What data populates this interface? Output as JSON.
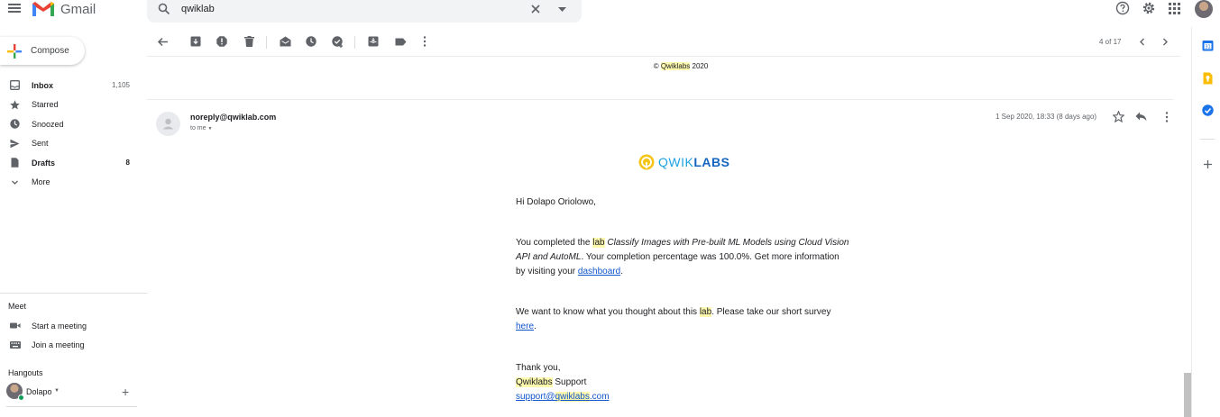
{
  "app": {
    "name": "Gmail"
  },
  "search": {
    "query": "qwiklab"
  },
  "compose": {
    "label": "Compose"
  },
  "nav": {
    "items": [
      {
        "label": "Inbox",
        "count": "1,105",
        "bold": true,
        "icon": "inbox-icon"
      },
      {
        "label": "Starred",
        "count": "",
        "bold": false,
        "icon": "star-icon"
      },
      {
        "label": "Snoozed",
        "count": "",
        "bold": false,
        "icon": "clock-icon"
      },
      {
        "label": "Sent",
        "count": "",
        "bold": false,
        "icon": "send-icon"
      },
      {
        "label": "Drafts",
        "count": "8",
        "bold": true,
        "icon": "draft-icon"
      },
      {
        "label": "More",
        "count": "",
        "bold": false,
        "icon": "chevron-down-icon"
      }
    ]
  },
  "meet": {
    "title": "Meet",
    "start": "Start a meeting",
    "join": "Join a meeting"
  },
  "hangouts": {
    "title": "Hangouts",
    "user": "Dolapo"
  },
  "toolbar": {
    "pager": "4 of 17"
  },
  "prev_message": {
    "copyright_prefix": "© ",
    "copyright_brand": "Qwiklabs",
    "copyright_year": " 2020"
  },
  "message": {
    "sender": "noreply@qwiklab.com",
    "to": "to me",
    "date": "1 Sep 2020, 18:33 (8 days ago)"
  },
  "body": {
    "brand_a": "QWIK",
    "brand_b": "LABS",
    "greeting": "Hi Dolapo Oriolowo,",
    "p1_a": "You completed the ",
    "p1_hl": "lab",
    "p1_space": " ",
    "p1_title": "Classify Images with Pre-built ML Models using Cloud Vision API and AutoML",
    "p1_b": ". Your completion percentage was 100.0%. Get more information by visiting your ",
    "p1_link": "dashboard",
    "p1_end": ".",
    "p2_a": "We want to know what you thought about this ",
    "p2_hl": "lab",
    "p2_b": ". Please take our short survey ",
    "p2_link": "here",
    "p2_end": ".",
    "thanks": "Thank you,",
    "sig_brand": "Qwiklabs",
    "sig_rest": " Support",
    "email_a": "support@",
    "email_hl": "qwiklabs",
    "email_b": ".com"
  },
  "colors": {
    "accent_blue": "#1a73e8",
    "highlight": "#fcf8ae",
    "link": "#1155cc"
  }
}
